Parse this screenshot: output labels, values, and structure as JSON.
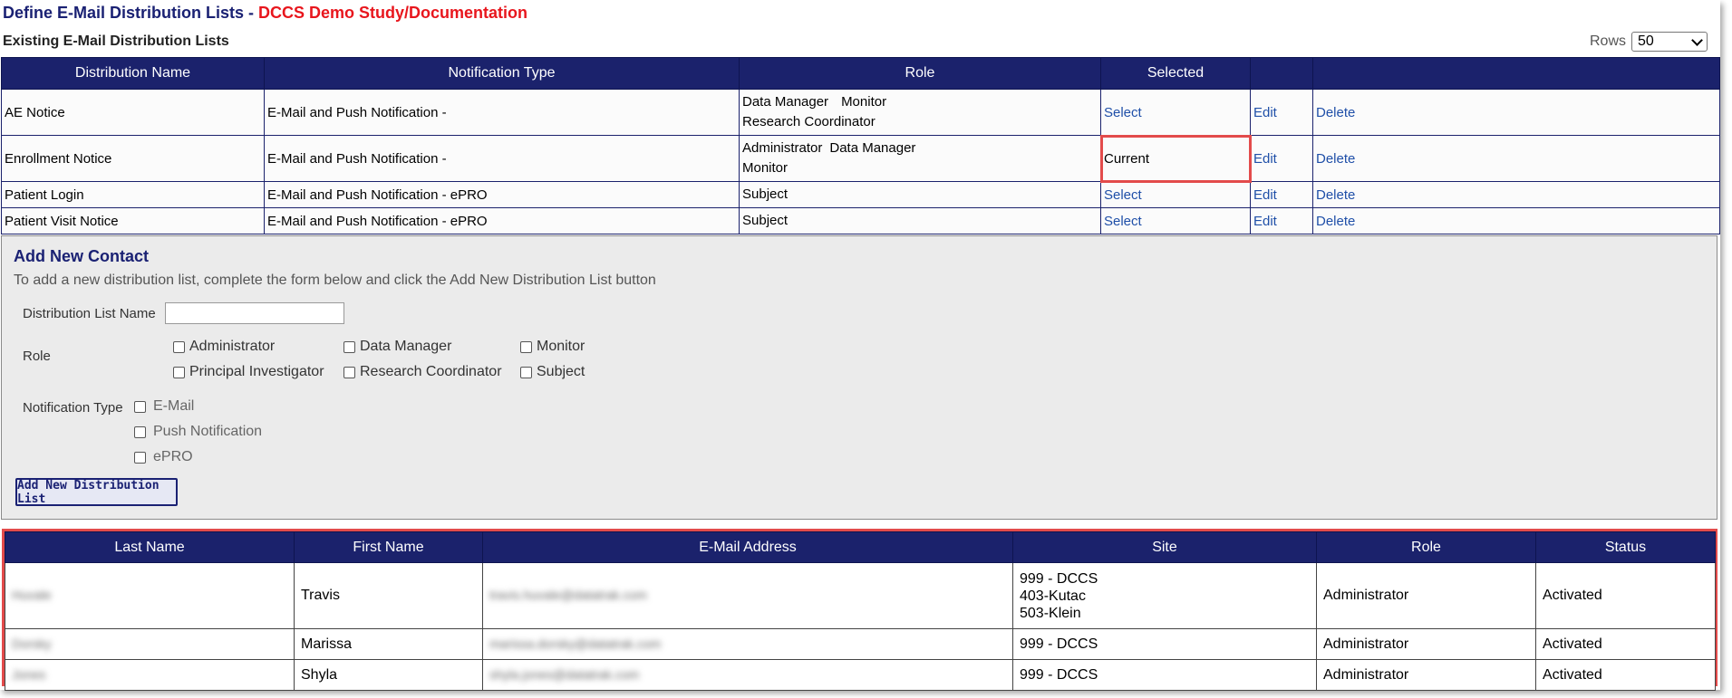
{
  "page": {
    "title": "Define E-Mail Distribution Lists - ",
    "study": "DCCS Demo Study/Documentation"
  },
  "existing": {
    "heading": "Existing E-Mail Distribution Lists",
    "rows_label": "Rows",
    "rows_value": "50",
    "columns": [
      "Distribution Name",
      "Notification Type",
      "Role",
      "Selected",
      "",
      ""
    ],
    "rows": [
      {
        "name": "AE Notice",
        "type": "E-Mail and Push Notification -",
        "roles": [
          "Data Manager",
          "Monitor",
          "Research Coordinator"
        ],
        "selected": "Select",
        "edit": "Edit",
        "delete": "Delete"
      },
      {
        "name": "Enrollment Notice",
        "type": "E-Mail and Push Notification -",
        "roles": [
          "Administrator",
          "Data Manager",
          "Monitor"
        ],
        "selected": "Current",
        "edit": "Edit",
        "delete": "Delete"
      },
      {
        "name": "Patient Login",
        "type": "E-Mail and Push Notification - ePRO",
        "roles": [
          "Subject"
        ],
        "selected": "Select",
        "edit": "Edit",
        "delete": "Delete"
      },
      {
        "name": "Patient Visit Notice",
        "type": "E-Mail and Push Notification - ePRO",
        "roles": [
          "Subject"
        ],
        "selected": "Select",
        "edit": "Edit",
        "delete": "Delete"
      }
    ]
  },
  "add_contact": {
    "title": "Add New Contact",
    "description": "To add a new distribution list, complete the form below and click the Add New Distribution List button",
    "name_label": "Distribution List Name",
    "name_value": "",
    "role_label": "Role",
    "roles": [
      "Administrator",
      "Data Manager",
      "Monitor",
      "Principal Investigator",
      "Research Coordinator",
      "Subject"
    ],
    "notification_label": "Notification Type",
    "notification_types": [
      "E-Mail",
      "Push Notification",
      "ePRO"
    ],
    "button": "Add New Distribution List"
  },
  "contacts": {
    "columns": [
      "Last Name",
      "First Name",
      "E-Mail Address",
      "Site",
      "Role",
      "Status"
    ],
    "rows": [
      {
        "last": "Huvale",
        "first": "Travis",
        "email": "travis.huvale@datatrak.com",
        "sites": [
          "999 - DCCS",
          "403-Kutac",
          "503-Klein"
        ],
        "role": "Administrator",
        "status": "Activated"
      },
      {
        "last": "Dorsky",
        "first": "Marissa",
        "email": "marissa.dorsky@datatrak.com",
        "sites": [
          "999 - DCCS"
        ],
        "role": "Administrator",
        "status": "Activated"
      },
      {
        "last": "Jones",
        "first": "Shyla",
        "email": "shyla.jones@datatrak.com",
        "sites": [
          "999 - DCCS"
        ],
        "role": "Administrator",
        "status": "Activated"
      }
    ]
  },
  "colors": {
    "header_navy": "#1b226c",
    "title_navy": "#1a2173",
    "study_red": "#e8161d",
    "highlight_red": "#e34b4b",
    "link_blue": "#1f4fa8"
  }
}
